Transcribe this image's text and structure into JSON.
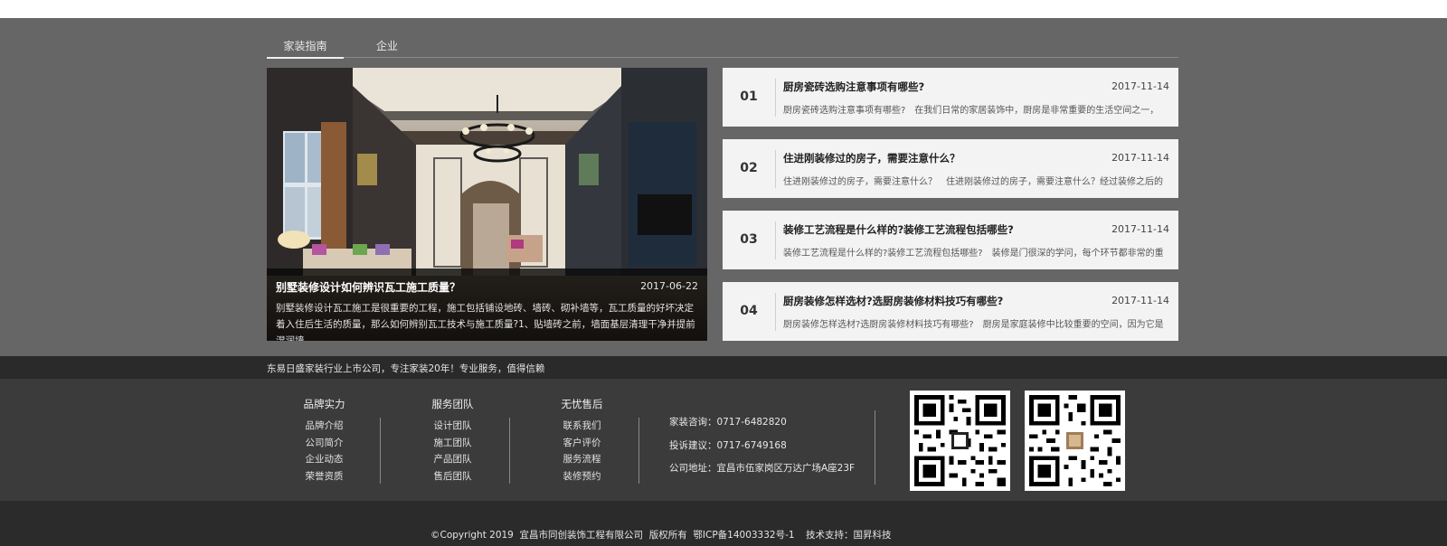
{
  "tabs": [
    "家装指南",
    "企业"
  ],
  "feature": {
    "title": "别墅装修设计如何辨识瓦工施工质量？",
    "date": "2017-06-22",
    "text": "别墅装修设计瓦工施工是很重要的工程，施工包括铺设地砖、墙砖、砌补墙等，瓦工质量的好坏决定着入住后生活的质量，那么如何辨别瓦工技术与施工质量?1、贴墙砖之前，墙面基层清理干净并提前湿润墙"
  },
  "news": [
    {
      "num": "01",
      "title": "厨房瓷砖选购注意事项有哪些?",
      "date": "2017-11-14",
      "text": "厨房瓷砖选购注意事项有哪些?　在我们日常的家居装饰中，厨房是非常重要的生活空间之一，"
    },
    {
      "num": "02",
      "title": "住进刚装修过的房子，需要注意什么？",
      "date": "2017-11-14",
      "text": "住进刚装修过的房子，需要注意什么？　住进刚装修过的房子，需要注意什么？经过装修之后的"
    },
    {
      "num": "03",
      "title": "装修工艺流程是什么样的?装修工艺流程包括哪些?",
      "date": "2017-11-14",
      "text": "装修工艺流程是什么样的?装修工艺流程包括哪些?　装修是门很深的学问，每个环节都非常的重"
    },
    {
      "num": "04",
      "title": "厨房装修怎样选材?选厨房装修材料技巧有哪些?",
      "date": "2017-11-14",
      "text": "厨房装修怎样选材?选厨房装修材料技巧有哪些?　厨房是家庭装修中比较重要的空间，因为它是"
    }
  ],
  "slogan": "东易日盛家装行业上市公司，专注家装20年！专业服务，值得信赖",
  "footer": {
    "columns": [
      {
        "title": "品牌实力",
        "links": [
          "品牌介绍",
          "公司简介",
          "企业动态",
          "荣誉资质"
        ]
      },
      {
        "title": "服务团队",
        "links": [
          "设计团队",
          "施工团队",
          "产品团队",
          "售后团队"
        ]
      },
      {
        "title": "无忧售后",
        "links": [
          "联系我们",
          "客户评价",
          "服务流程",
          "装修预约"
        ]
      }
    ],
    "contact": [
      "家装咨询：0717-6482820",
      "投诉建议：0717-6749168",
      "公司地址：宜昌市伍家岗区万达广场A座23F"
    ],
    "copyright": "©Copyright 2019  宜昌市同创装饰工程有限公司  版权所有  鄂ICP备14003332号-1",
    "tech": "技术支持：国昇科技"
  }
}
